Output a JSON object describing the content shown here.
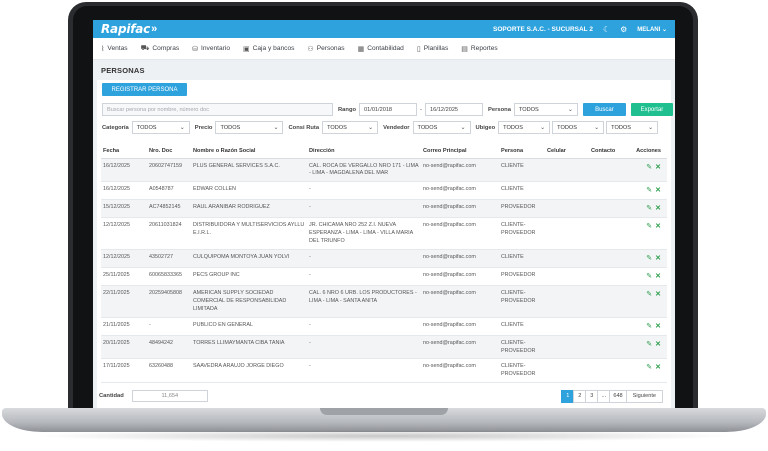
{
  "app": {
    "logo": "Rapifac",
    "company": "SOPORTE S.A.C. - SUCURSAL 2",
    "user": "MELANI"
  },
  "menu": [
    {
      "label": "Ventas",
      "icon": "chart-icon"
    },
    {
      "label": "Compras",
      "icon": "cart-icon"
    },
    {
      "label": "Inventario",
      "icon": "boxes-icon"
    },
    {
      "label": "Caja y bancos",
      "icon": "cash-icon"
    },
    {
      "label": "Personas",
      "icon": "people-icon"
    },
    {
      "label": "Contabilidad",
      "icon": "calculator-icon"
    },
    {
      "label": "Planillas",
      "icon": "document-icon"
    },
    {
      "label": "Reportes",
      "icon": "report-icon"
    }
  ],
  "page": {
    "title": "PERSONAS",
    "register_button": "REGISTRAR PERSONA"
  },
  "filters": {
    "search_placeholder": "Buscar persona por nombre, número doc",
    "rango_label": "Rango",
    "date_from": "01/01/2018",
    "date_to": "16/12/2025",
    "persona_label": "Persona",
    "persona_value": "TODOS",
    "search_button": "Buscar",
    "export_button": "Exportar",
    "categoria_label": "Categoría",
    "categoria_value": "TODOS",
    "precio_label": "Precio",
    "precio_value": "TODOS",
    "consi_label": "Consi Ruta",
    "consi_value": "TODOS",
    "vendedor_label": "Vendedor",
    "vendedor_value": "TODOS",
    "ubigeo_label": "Ubigeo",
    "ubigeo_values": [
      "TODOS",
      "TODOS",
      "TODOS"
    ]
  },
  "table": {
    "headers": [
      "Fecha",
      "Nro. Doc",
      "Nombre o Razón Social",
      "Dirección",
      "Correo Principal",
      "Persona",
      "Celular",
      "Contacto",
      "Acciones"
    ],
    "rows": [
      [
        "16/12/2025",
        "20602747159",
        "PLUS GENERAL SERVICES S.A.C.",
        "CAL. ROCA DE VERGALLO NRO 171 - LIMA - LIMA - MAGDALENA DEL MAR",
        "no-send@rapifac.com",
        "CLIENTE",
        "",
        ""
      ],
      [
        "16/12/2025",
        "A0548787",
        "EDWAR COLLEN",
        "-",
        "no-send@rapifac.com",
        "CLIENTE",
        "",
        ""
      ],
      [
        "15/12/2025",
        "AC74852145",
        "RAUL ARANIBAR RODRIGUEZ",
        "-",
        "no-send@rapifac.com",
        "PROVEEDOR",
        "",
        ""
      ],
      [
        "12/12/2025",
        "20611031824",
        "DISTRIBUIDORA Y MULTISERVICIOS AYLLU E.I.R.L.",
        "JR. CHICAMA NRO 252 Z.I. NUEVA ESPERANZA - LIMA - LIMA - VILLA MARIA DEL TRIUNFO",
        "no-send@rapifac.com",
        "CLIENTE-PROVEEDOR",
        "",
        ""
      ],
      [
        "12/12/2025",
        "43502727",
        "CULQUIPOMA MONTOYA JUAN YOLVI",
        "-",
        "no-send@rapifac.com",
        "CLIENTE",
        "",
        ""
      ],
      [
        "25/11/2025",
        "60065833365",
        "PECS GROUP INC",
        "-",
        "no-send@rapifac.com",
        "PROVEEDOR",
        "",
        ""
      ],
      [
        "22/11/2025",
        "20259405808",
        "AMERICAN SUPPLY SOCIEDAD COMERCIAL DE RESPONSABILIDAD LIMITADA",
        "CAL. 6 NRO 6 URB. LOS PRODUCTORES - LIMA - LIMA - SANTA ANITA",
        "no-send@rapifac.com",
        "CLIENTE-PROVEEDOR",
        "",
        ""
      ],
      [
        "21/11/2025",
        "-",
        "PUBLICO EN GENERAL",
        "-",
        "no-send@rapifac.com",
        "CLIENTE",
        "",
        ""
      ],
      [
        "20/11/2025",
        "48494242",
        "TORRES LLIMAYMANTA CIBA TANIA",
        "-",
        "no-send@rapifac.com",
        "CLIENTE-PROVEEDOR",
        "",
        ""
      ],
      [
        "17/11/2025",
        "63260488",
        "SAAVEDRA ARAUJO JORGE DIEGO",
        "-",
        "no-send@rapifac.com",
        "CLIENTE-PROVEEDOR",
        "",
        ""
      ]
    ]
  },
  "footer": {
    "cantidad_label": "Cantidad",
    "cantidad_value": "11,654",
    "pages": [
      "1",
      "2",
      "3",
      "...",
      "648"
    ],
    "next_label": "Siguiente"
  }
}
